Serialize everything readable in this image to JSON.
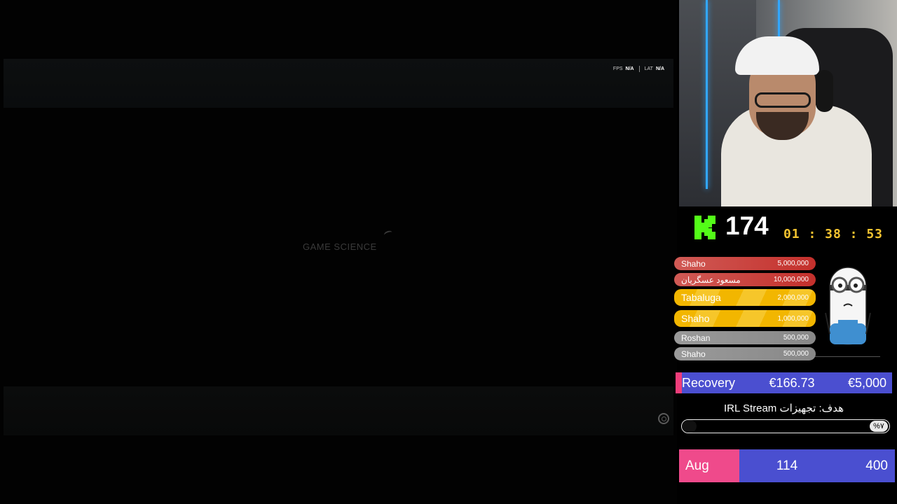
{
  "game": {
    "fps_label": "FPS",
    "fps_value": "N/A",
    "lat_label": "LAT",
    "lat_value": "N/A",
    "studio_logo": "GAME SCIENCE"
  },
  "overlay": {
    "viewer_count": "174",
    "stream_timer": "01 : 38 : 53",
    "donors": [
      {
        "name": "Shaho",
        "amount": "5,000,000",
        "style": "red"
      },
      {
        "name": "مسعود عسگریان",
        "amount": "10,000,000",
        "style": "red"
      },
      {
        "name": "Tabaluga",
        "amount": "2,000,000",
        "style": "gold"
      },
      {
        "name": "Shaho",
        "amount": "1,000,000",
        "style": "gold"
      },
      {
        "name": "Roshan",
        "amount": "500,000",
        "style": "gray"
      },
      {
        "name": "Shaho",
        "amount": "500,000",
        "style": "gray"
      }
    ],
    "recovery": {
      "label": "Recovery",
      "current": "€166.73",
      "goal": "€5,000"
    },
    "goal": {
      "title": "هدف: تجهیزات IRL Stream",
      "percent": "%۷",
      "progress": 0.07
    },
    "month": {
      "name": "Aug",
      "current": "114",
      "target": "400"
    }
  },
  "colors": {
    "kick_green": "#53fc18",
    "timer_yellow": "#f4c430",
    "accent_pink": "#ef4a8b",
    "accent_blue": "#4a4fd0"
  }
}
